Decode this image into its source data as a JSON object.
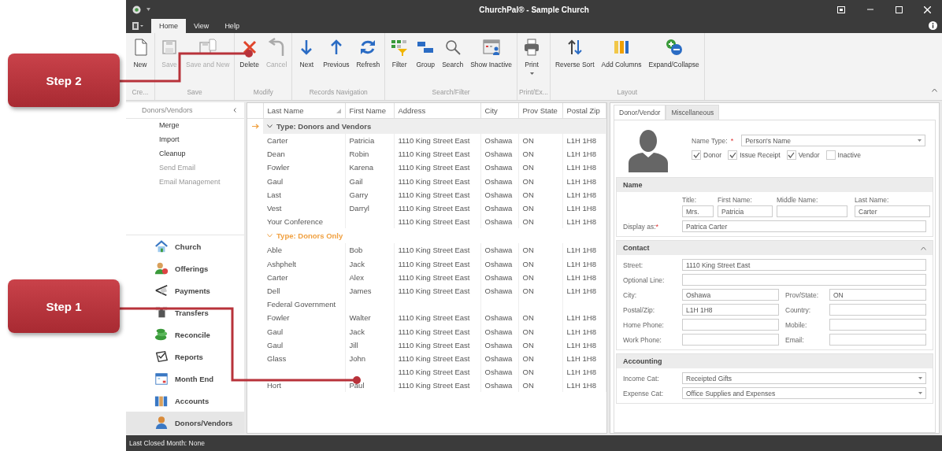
{
  "window": {
    "title": "ChurchPal® - Sample Church"
  },
  "menu_tabs": [
    {
      "label": "Home",
      "selected": true
    },
    {
      "label": "View",
      "selected": false
    },
    {
      "label": "Help",
      "selected": false
    }
  ],
  "ribbon": {
    "groups": [
      {
        "caption": "Cre...",
        "buttons": [
          {
            "label": "New",
            "kind": "new",
            "disabled": false
          }
        ]
      },
      {
        "caption": "Save",
        "buttons": [
          {
            "label": "Save",
            "kind": "save",
            "disabled": true
          },
          {
            "label": "Save and New",
            "kind": "save_new",
            "disabled": true
          }
        ]
      },
      {
        "caption": "Modify",
        "buttons": [
          {
            "label": "Delete",
            "kind": "delete",
            "disabled": false
          },
          {
            "label": "Cancel",
            "kind": "cancel",
            "disabled": true
          }
        ]
      },
      {
        "caption": "Records Navigation",
        "buttons": [
          {
            "label": "Next",
            "kind": "next",
            "disabled": false
          },
          {
            "label": "Previous",
            "kind": "previous",
            "disabled": false
          },
          {
            "label": "Refresh",
            "kind": "refresh",
            "disabled": false
          }
        ]
      },
      {
        "caption": "Search/Filter",
        "buttons": [
          {
            "label": "Filter",
            "kind": "filter",
            "disabled": false
          },
          {
            "label": "Group",
            "kind": "group",
            "disabled": false
          },
          {
            "label": "Search",
            "kind": "search",
            "disabled": false
          },
          {
            "label": "Show Inactive",
            "kind": "show_inactive",
            "disabled": false
          }
        ]
      },
      {
        "caption": "Print/Ex...",
        "buttons": [
          {
            "label": "Print",
            "kind": "print",
            "disabled": false,
            "dropdown": true
          }
        ]
      },
      {
        "caption": "Layout",
        "buttons": [
          {
            "label": "Reverse Sort",
            "kind": "reverse_sort",
            "disabled": false
          },
          {
            "label": "Add Columns",
            "kind": "add_columns",
            "disabled": false
          },
          {
            "label": "Expand/Collapse",
            "kind": "expand_collapse",
            "disabled": false
          }
        ]
      }
    ]
  },
  "sidebar": {
    "header": "Donors/Vendors",
    "actions": [
      {
        "label": "Merge",
        "disabled": false
      },
      {
        "label": "Import",
        "disabled": false
      },
      {
        "label": "Cleanup",
        "disabled": false
      },
      {
        "label": "Send Email",
        "disabled": true
      },
      {
        "label": "Email Management",
        "disabled": true
      }
    ],
    "modules": [
      {
        "label": "Church",
        "kind": "church",
        "selected": false
      },
      {
        "label": "Offerings",
        "kind": "offerings",
        "selected": false
      },
      {
        "label": "Payments",
        "kind": "payments",
        "selected": false
      },
      {
        "label": "Transfers",
        "kind": "transfers",
        "selected": false
      },
      {
        "label": "Reconcile",
        "kind": "reconcile",
        "selected": false
      },
      {
        "label": "Reports",
        "kind": "reports",
        "selected": false
      },
      {
        "label": "Month End",
        "kind": "month_end",
        "selected": false
      },
      {
        "label": "Accounts",
        "kind": "accounts",
        "selected": false
      },
      {
        "label": "Donors/Vendors",
        "kind": "donors",
        "selected": true
      }
    ]
  },
  "grid": {
    "columns": [
      {
        "label": "Last Name",
        "sorted": true
      },
      {
        "label": "First Name",
        "sorted": false
      },
      {
        "label": "Address",
        "sorted": false
      },
      {
        "label": "City",
        "sorted": false
      },
      {
        "label": "Prov State",
        "sorted": false
      },
      {
        "label": "Postal Zip",
        "sorted": false
      }
    ],
    "groups": [
      {
        "title": "Type: Donors and Vendors",
        "focused": true,
        "rows": [
          [
            "Carter",
            "Patricia",
            "1110 King Street East",
            "Oshawa",
            "ON",
            "L1H 1H8"
          ],
          [
            "Dean",
            "Robin",
            "1110 King Street East",
            "Oshawa",
            "ON",
            "L1H 1H8"
          ],
          [
            "Fowler",
            "Karena",
            "1110 King Street East",
            "Oshawa",
            "ON",
            "L1H 1H8"
          ],
          [
            "Gaul",
            "Gail",
            "1110 King Street East",
            "Oshawa",
            "ON",
            "L1H 1H8"
          ],
          [
            "Last",
            "Garry",
            "1110 King Street East",
            "Oshawa",
            "ON",
            "L1H 1H8"
          ],
          [
            "Vest",
            "Darryl",
            "1110 King Street East",
            "Oshawa",
            "ON",
            "L1H 1H8"
          ],
          [
            "Your Conference",
            null,
            "1110 King Street East",
            "Oshawa",
            "ON",
            "L1H 1H8"
          ]
        ]
      },
      {
        "title": "Type: Donors Only",
        "focused": false,
        "rows": [
          [
            "Able",
            "Bob",
            "1110 King Street East",
            "Oshawa",
            "ON",
            "L1H 1H8"
          ],
          [
            "Ashphelt",
            "Jack",
            "1110 King Street East",
            "Oshawa",
            "ON",
            "L1H 1H8"
          ],
          [
            "Carter",
            "Alex",
            "1110 King Street East",
            "Oshawa",
            "ON",
            "L1H 1H8"
          ],
          [
            "Dell",
            "James",
            "1110 King Street East",
            "Oshawa",
            "ON",
            "L1H 1H8"
          ],
          [
            "Federal Government",
            null,
            null,
            null,
            null,
            null
          ],
          [
            "Fowler",
            "Walter",
            "1110 King Street East",
            "Oshawa",
            "ON",
            "L1H 1H8"
          ],
          [
            "Gaul",
            "Jack",
            "1110 King Street East",
            "Oshawa",
            "ON",
            "L1H 1H8"
          ],
          [
            "Gaul",
            "Jill",
            "1110 King Street East",
            "Oshawa",
            "ON",
            "L1H 1H8"
          ],
          [
            "Glass",
            "John",
            "1110 King Street East",
            "Oshawa",
            "ON",
            "L1H 1H8"
          ],
          [
            null,
            null,
            "1110 King Street East",
            "Oshawa",
            "ON",
            "L1H 1H8"
          ],
          [
            "Hort",
            "Paul",
            "1110 King Street East",
            "Oshawa",
            "ON",
            "L1H 1H8"
          ]
        ]
      }
    ]
  },
  "detail": {
    "tabs": [
      {
        "label": "Donor/Vendor",
        "selected": true
      },
      {
        "label": "Miscellaneous",
        "selected": false
      }
    ],
    "name_type": {
      "label": "Name Type:",
      "required_mark": "*",
      "value": "Person's Name"
    },
    "flags": [
      {
        "label": "Donor",
        "checked": true
      },
      {
        "label": "Issue Receipt",
        "checked": true
      },
      {
        "label": "Vendor",
        "checked": true
      },
      {
        "label": "Inactive",
        "checked": false
      }
    ],
    "name_section": {
      "title": "Name",
      "fields": [
        {
          "label": "Title:",
          "value": "Mrs."
        },
        {
          "label": "First Name:",
          "value": "Patricia"
        },
        {
          "label": "Middle Name:"
        },
        {
          "label": "Last Name:",
          "value": "Carter"
        }
      ],
      "display": {
        "label": "Display as:",
        "required_mark": "*",
        "value": "Patrica Carter"
      }
    },
    "sections": [
      {
        "title": "Contact",
        "collapsible": true,
        "rows": [
          [
            {
              "label": "Street:",
              "value": "1110 King Street East",
              "kind": "text"
            }
          ],
          [
            {
              "label": "Optional Line:",
              "kind": "text"
            }
          ],
          [
            {
              "label": "City:",
              "value": "Oshawa",
              "kind": "text"
            },
            {
              "label": "Prov/State:",
              "value": "ON",
              "kind": "text"
            }
          ],
          [
            {
              "label": "Postal/Zip:",
              "value": "L1H 1H8",
              "kind": "text"
            },
            {
              "label": "Country:",
              "kind": "text"
            }
          ],
          [
            {
              "label": "Home Phone:",
              "kind": "text"
            },
            {
              "label": "Mobile:",
              "kind": "text"
            }
          ],
          [
            {
              "label": "Work Phone:",
              "kind": "text"
            },
            {
              "label": "Email:",
              "kind": "text"
            }
          ]
        ]
      },
      {
        "title": "Accounting",
        "collapsible": false,
        "rows": [
          [
            {
              "label": "Income Cat:",
              "value": "Receipted Gifts",
              "kind": "dropdown"
            }
          ],
          [
            {
              "label": "Expense Cat:",
              "value": "Office Supplies and Expenses",
              "kind": "dropdown"
            }
          ]
        ]
      }
    ]
  },
  "status_bar": {
    "text": "Last Closed Month: None"
  },
  "callouts": [
    {
      "label": "Step 2"
    },
    {
      "label": "Step 1"
    }
  ]
}
